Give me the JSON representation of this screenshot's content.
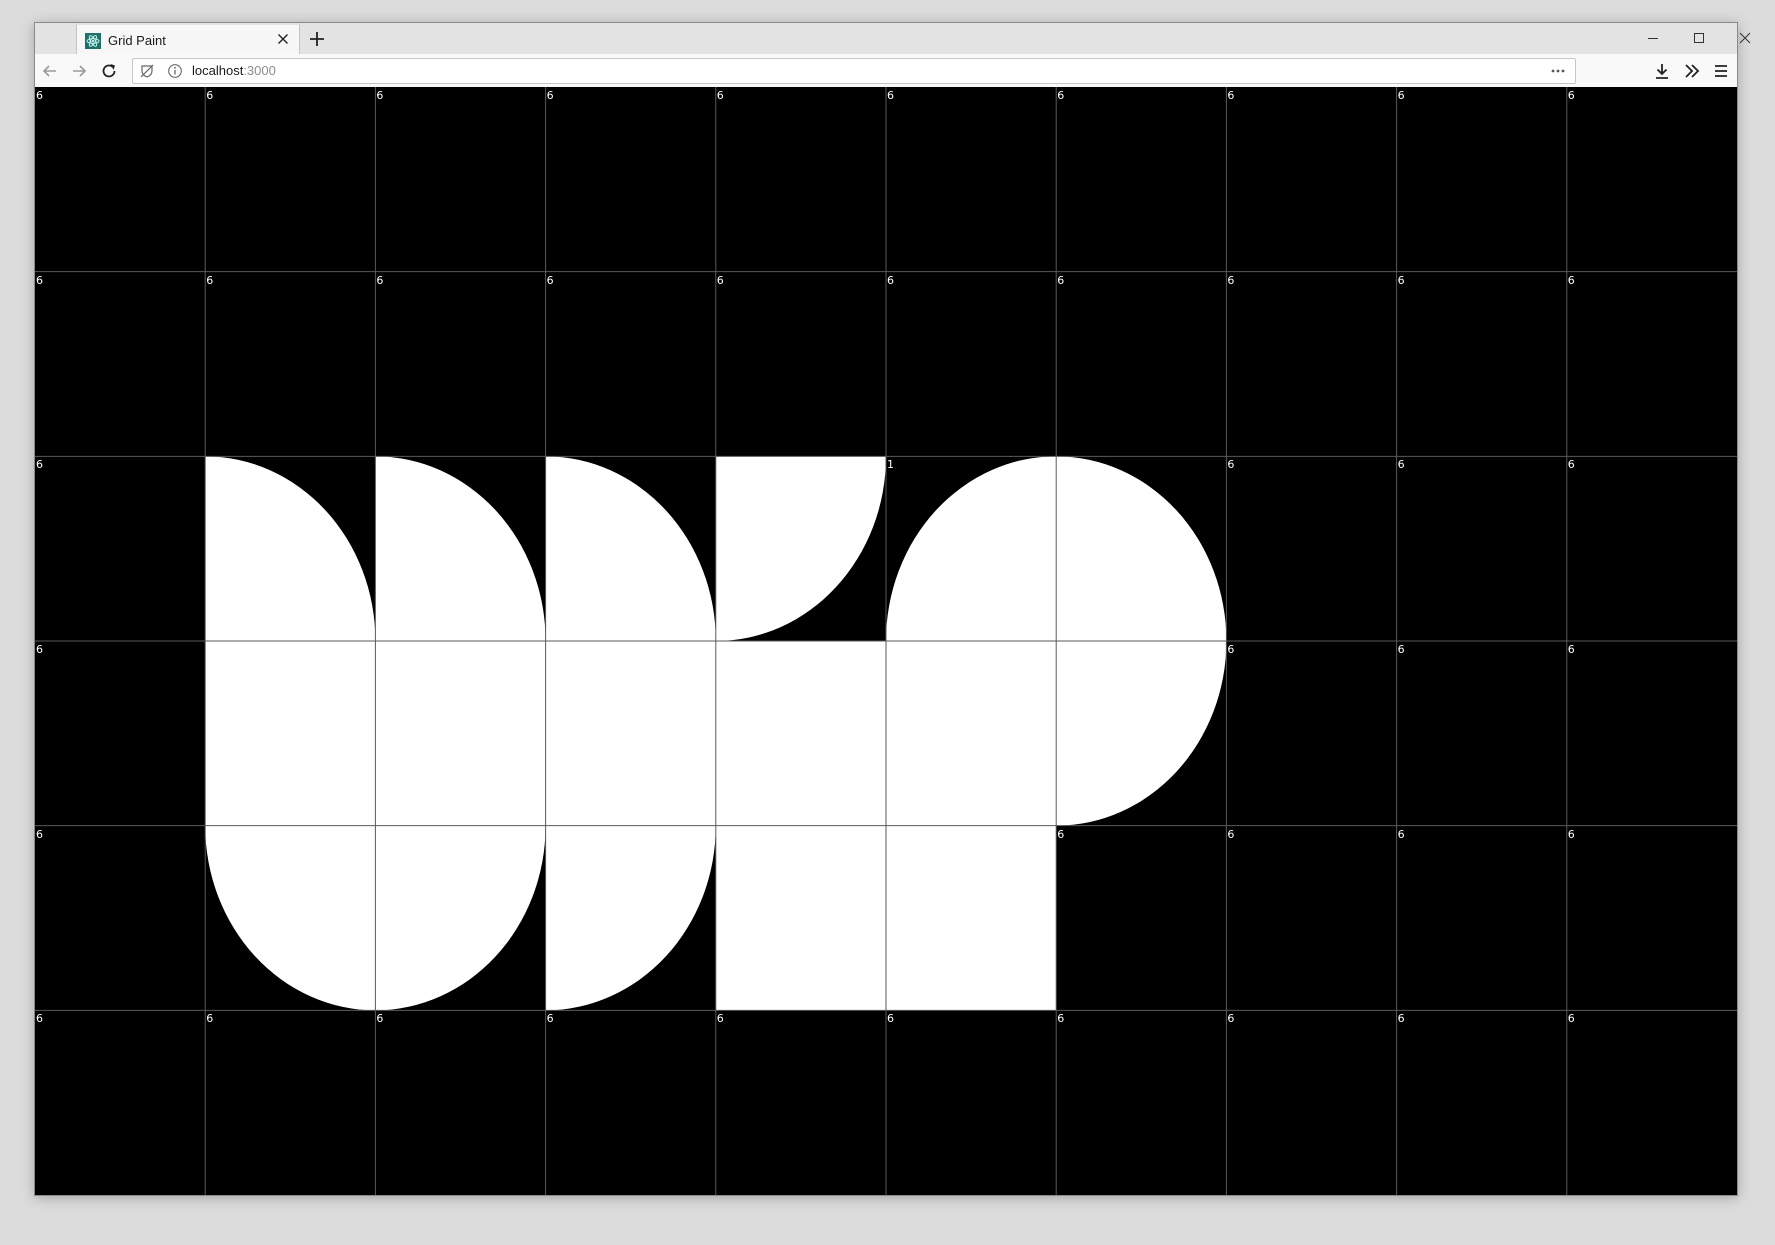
{
  "browser": {
    "tab_title": "Grid Paint",
    "url_host": "localhost",
    "url_port": ":3000"
  },
  "grid": {
    "cols": 10,
    "rows": 6,
    "background": "#000000",
    "fill": "#ffffff",
    "line_color": "#5a5a5a",
    "cells": [
      [
        {
          "label": "6",
          "shape": "empty"
        },
        {
          "label": "6",
          "shape": "empty"
        },
        {
          "label": "6",
          "shape": "empty"
        },
        {
          "label": "6",
          "shape": "empty"
        },
        {
          "label": "6",
          "shape": "empty"
        },
        {
          "label": "6",
          "shape": "empty"
        },
        {
          "label": "6",
          "shape": "empty"
        },
        {
          "label": "6",
          "shape": "empty"
        },
        {
          "label": "6",
          "shape": "empty"
        },
        {
          "label": "6",
          "shape": "empty"
        }
      ],
      [
        {
          "label": "6",
          "shape": "empty"
        },
        {
          "label": "6",
          "shape": "empty"
        },
        {
          "label": "6",
          "shape": "empty"
        },
        {
          "label": "6",
          "shape": "empty"
        },
        {
          "label": "6",
          "shape": "empty"
        },
        {
          "label": "6",
          "shape": "empty"
        },
        {
          "label": "6",
          "shape": "empty"
        },
        {
          "label": "6",
          "shape": "empty"
        },
        {
          "label": "6",
          "shape": "empty"
        },
        {
          "label": "6",
          "shape": "empty"
        }
      ],
      [
        {
          "label": "6",
          "shape": "empty"
        },
        {
          "label": "",
          "shape": "quarter-bl"
        },
        {
          "label": "",
          "shape": "quarter-bl"
        },
        {
          "label": "",
          "shape": "quarter-bl"
        },
        {
          "label": "",
          "shape": "quarter-tl"
        },
        {
          "label": "1",
          "shape": "quarter-br"
        },
        {
          "label": "",
          "shape": "quarter-bl"
        },
        {
          "label": "6",
          "shape": "empty"
        },
        {
          "label": "6",
          "shape": "empty"
        },
        {
          "label": "6",
          "shape": "empty"
        }
      ],
      [
        {
          "label": "6",
          "shape": "empty"
        },
        {
          "label": "",
          "shape": "full"
        },
        {
          "label": "",
          "shape": "full"
        },
        {
          "label": "",
          "shape": "full"
        },
        {
          "label": "",
          "shape": "full"
        },
        {
          "label": "",
          "shape": "full"
        },
        {
          "label": "",
          "shape": "quarter-tl"
        },
        {
          "label": "6",
          "shape": "empty"
        },
        {
          "label": "6",
          "shape": "empty"
        },
        {
          "label": "6",
          "shape": "empty"
        }
      ],
      [
        {
          "label": "6",
          "shape": "empty"
        },
        {
          "label": "",
          "shape": "quarter-tr"
        },
        {
          "label": "",
          "shape": "quarter-tl"
        },
        {
          "label": "",
          "shape": "quarter-tl"
        },
        {
          "label": "",
          "shape": "full"
        },
        {
          "label": "",
          "shape": "full"
        },
        {
          "label": "6",
          "shape": "empty"
        },
        {
          "label": "6",
          "shape": "empty"
        },
        {
          "label": "6",
          "shape": "empty"
        },
        {
          "label": "6",
          "shape": "empty"
        }
      ],
      [
        {
          "label": "6",
          "shape": "empty"
        },
        {
          "label": "6",
          "shape": "empty"
        },
        {
          "label": "6",
          "shape": "empty"
        },
        {
          "label": "6",
          "shape": "empty"
        },
        {
          "label": "6",
          "shape": "empty"
        },
        {
          "label": "6",
          "shape": "empty"
        },
        {
          "label": "6",
          "shape": "empty"
        },
        {
          "label": "6",
          "shape": "empty"
        },
        {
          "label": "6",
          "shape": "empty"
        },
        {
          "label": "6",
          "shape": "empty"
        }
      ]
    ]
  },
  "icons": {
    "favicon": "atom-favicon-icon",
    "tab_close": "close-icon",
    "new_tab": "plus-icon",
    "minimize": "minimize-icon",
    "maximize": "maximize-icon",
    "close_window": "close-window-icon",
    "back": "back-arrow-icon",
    "forward": "forward-arrow-icon",
    "reload": "reload-icon",
    "tracking": "tracking-protection-icon",
    "info": "info-icon",
    "page_actions": "ellipsis-icon",
    "downloads": "download-icon",
    "overflow": "chevron-double-right-icon",
    "menu": "hamburger-menu-icon"
  }
}
